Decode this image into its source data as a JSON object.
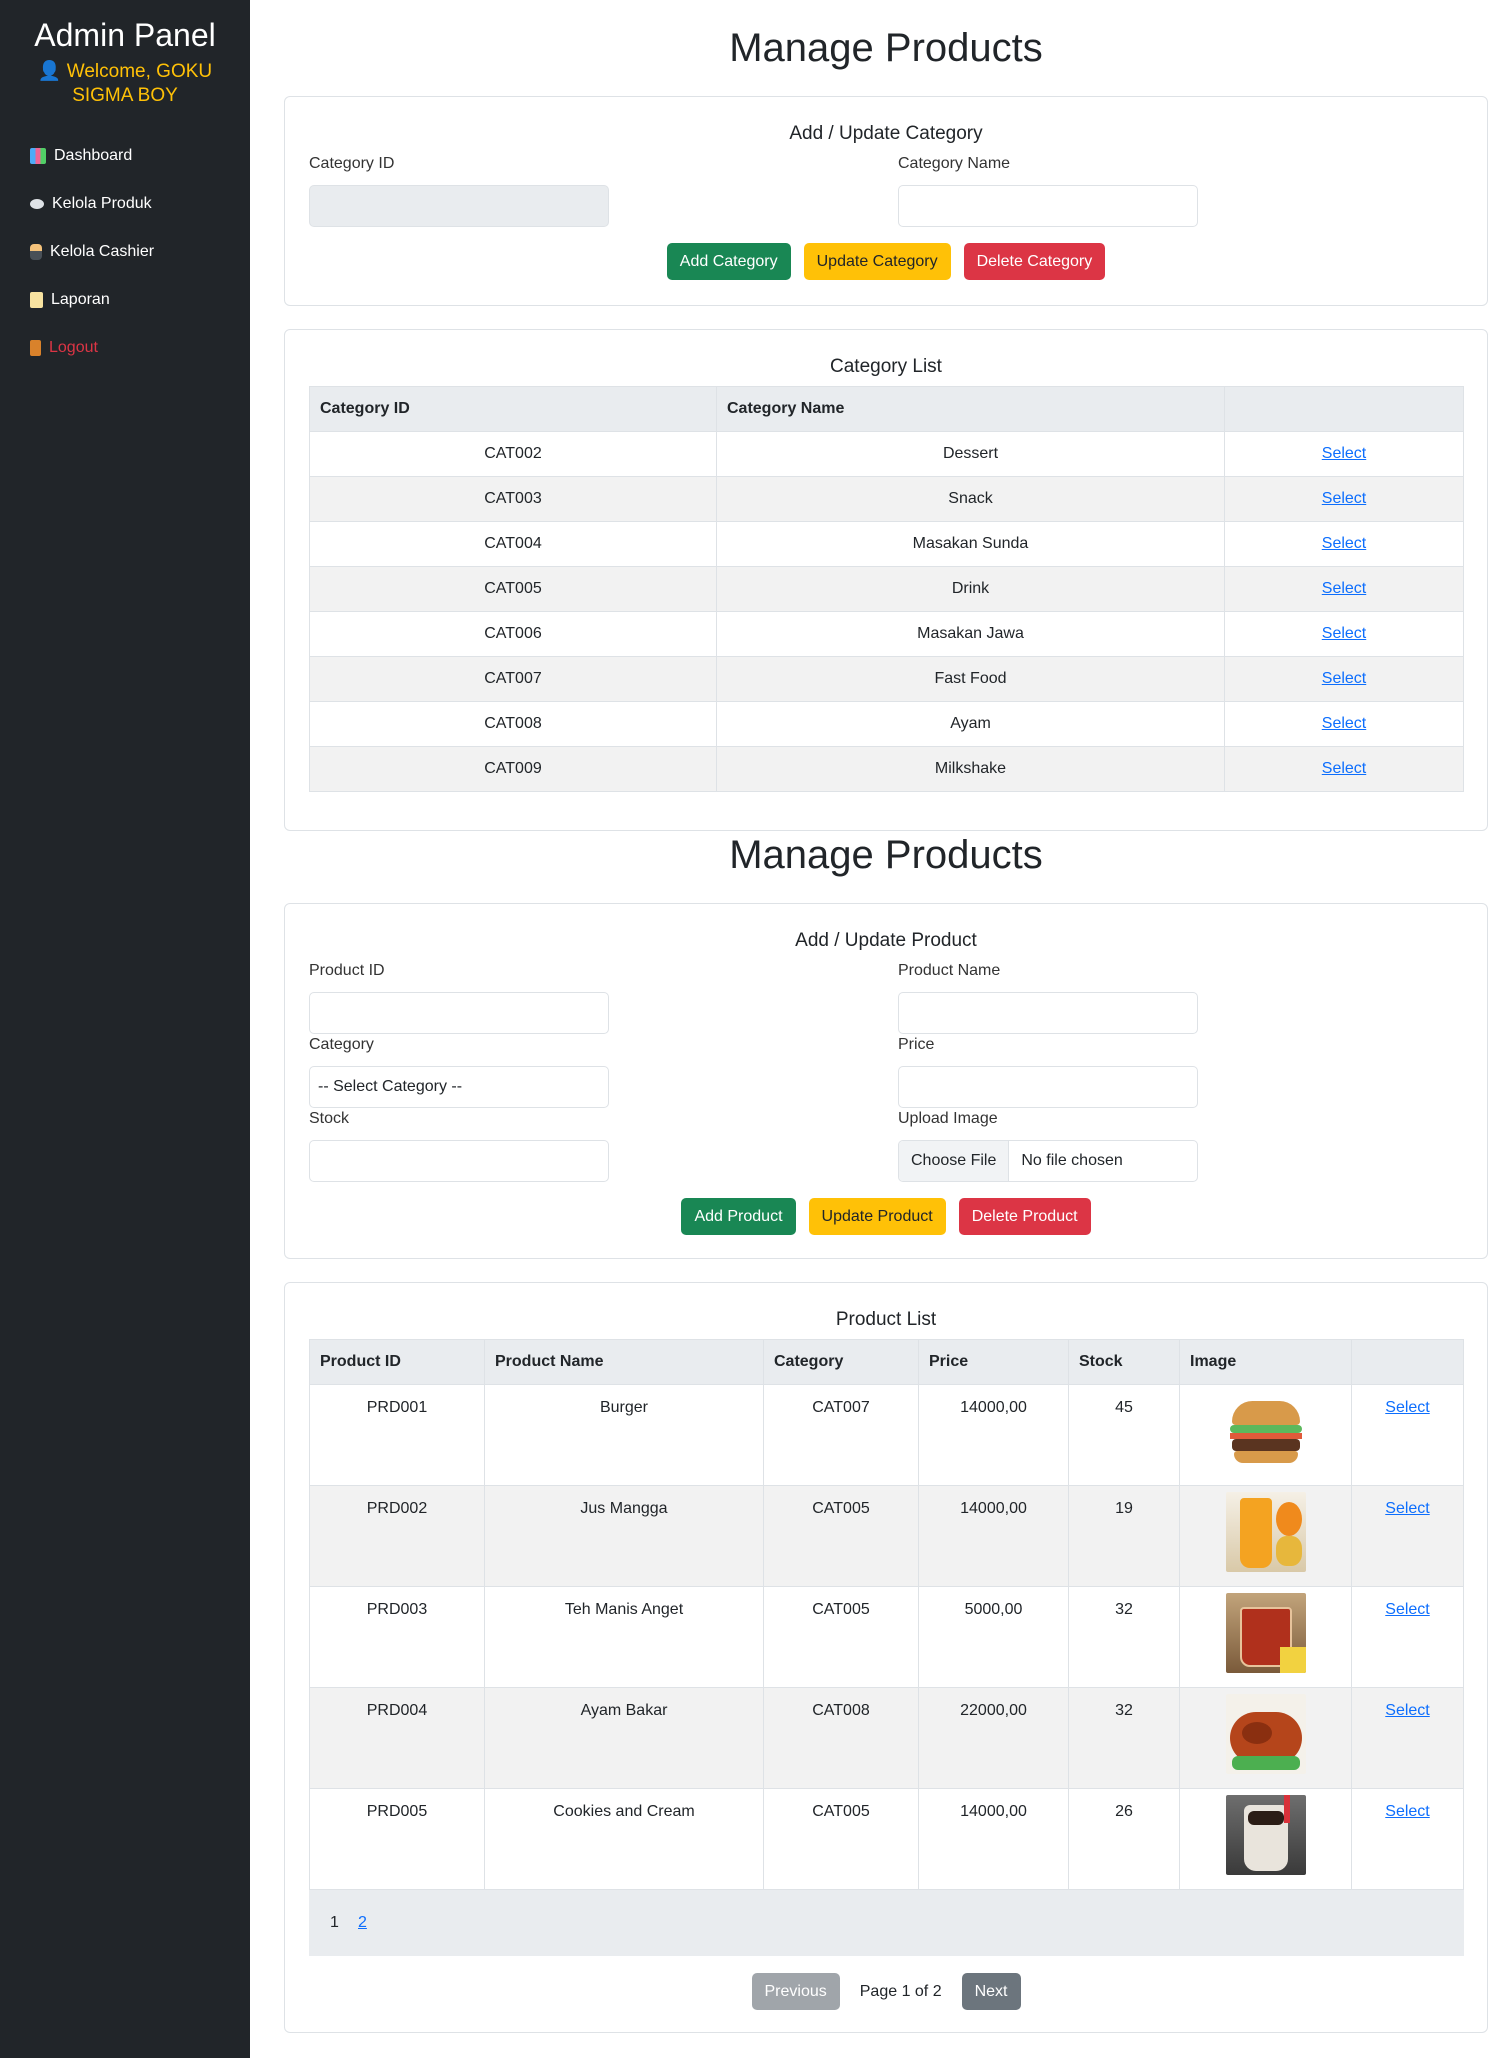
{
  "sidebar": {
    "title": "Admin Panel",
    "welcome_line1": "👤 Welcome, GOKU",
    "welcome_line2": "SIGMA BOY",
    "items": [
      {
        "label": "Dashboard",
        "icon": "chart-icon"
      },
      {
        "label": "Kelola Produk",
        "icon": "dish-icon"
      },
      {
        "label": "Kelola Cashier",
        "icon": "person-icon"
      },
      {
        "label": "Laporan",
        "icon": "scroll-icon"
      },
      {
        "label": "Logout",
        "icon": "door-icon"
      }
    ]
  },
  "page_title_top": "Manage Products",
  "category_form": {
    "title": "Add / Update Category",
    "id_label": "Category ID",
    "name_label": "Category Name",
    "id_value": "",
    "name_value": "",
    "add_button": "Add Category",
    "update_button": "Update Category",
    "delete_button": "Delete Category"
  },
  "category_list": {
    "title": "Category List",
    "headers": [
      "Category ID",
      "Category Name",
      ""
    ],
    "rows": [
      {
        "id": "CAT002",
        "name": "Dessert",
        "action": "Select"
      },
      {
        "id": "CAT003",
        "name": "Snack",
        "action": "Select"
      },
      {
        "id": "CAT004",
        "name": "Masakan Sunda",
        "action": "Select"
      },
      {
        "id": "CAT005",
        "name": "Drink",
        "action": "Select"
      },
      {
        "id": "CAT006",
        "name": "Masakan Jawa",
        "action": "Select"
      },
      {
        "id": "CAT007",
        "name": "Fast Food",
        "action": "Select"
      },
      {
        "id": "CAT008",
        "name": "Ayam",
        "action": "Select"
      },
      {
        "id": "CAT009",
        "name": "Milkshake",
        "action": "Select"
      }
    ]
  },
  "page_title_bottom": "Manage Products",
  "product_form": {
    "title": "Add / Update Product",
    "id_label": "Product ID",
    "name_label": "Product Name",
    "category_label": "Category",
    "category_selected": "-- Select Category --",
    "price_label": "Price",
    "stock_label": "Stock",
    "image_label": "Upload Image",
    "choose_file": "Choose File",
    "no_file": "No file chosen",
    "add_button": "Add Product",
    "update_button": "Update Product",
    "delete_button": "Delete Product"
  },
  "product_list": {
    "title": "Product List",
    "headers": [
      "Product ID",
      "Product Name",
      "Category",
      "Price",
      "Stock",
      "Image",
      ""
    ],
    "rows": [
      {
        "id": "PRD001",
        "name": "Burger",
        "category": "CAT007",
        "price": "14000,00",
        "stock": "45",
        "image": "burger-image",
        "action": "Select"
      },
      {
        "id": "PRD002",
        "name": "Jus Mangga",
        "category": "CAT005",
        "price": "14000,00",
        "stock": "19",
        "image": "mango-juice-image",
        "action": "Select"
      },
      {
        "id": "PRD003",
        "name": "Teh Manis Anget",
        "category": "CAT005",
        "price": "5000,00",
        "stock": "32",
        "image": "tea-image",
        "action": "Select"
      },
      {
        "id": "PRD004",
        "name": "Ayam Bakar",
        "category": "CAT008",
        "price": "22000,00",
        "stock": "32",
        "image": "grilled-chicken-image",
        "action": "Select"
      },
      {
        "id": "PRD005",
        "name": "Cookies and Cream",
        "category": "CAT005",
        "price": "14000,00",
        "stock": "26",
        "image": "milkshake-image",
        "action": "Select"
      }
    ],
    "pages": [
      "1",
      "2"
    ],
    "previous": "Previous",
    "page_info": "Page 1 of 2",
    "next": "Next"
  },
  "colors": {
    "sidebar_bg": "#212529",
    "welcome": "#ffc107",
    "success": "#198754",
    "warning": "#ffc107",
    "danger": "#dc3545",
    "link": "#0d6efd"
  }
}
